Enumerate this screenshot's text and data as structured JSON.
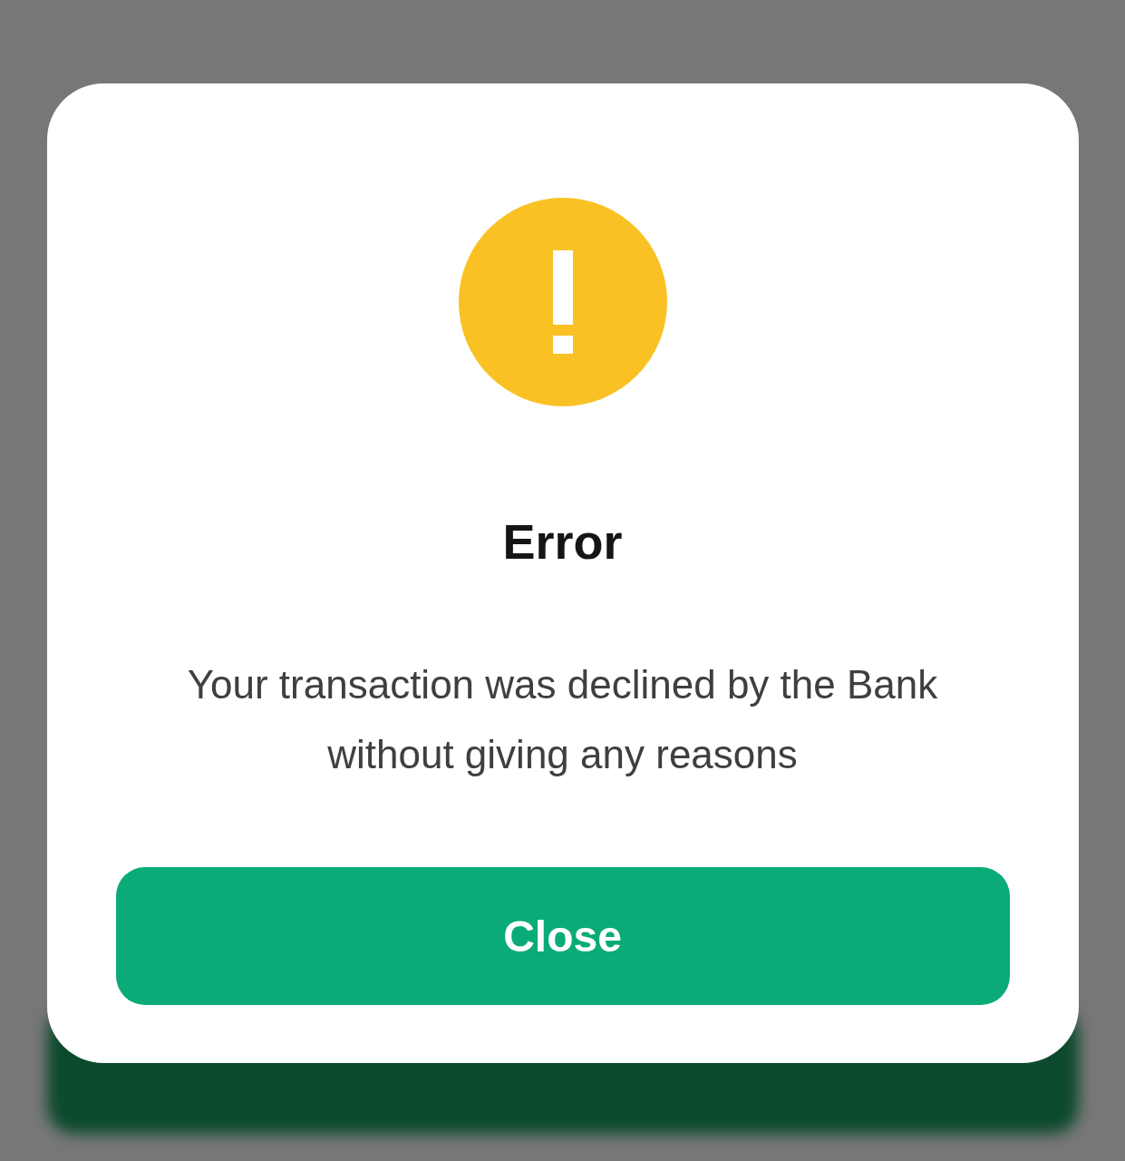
{
  "dialog": {
    "title": "Error",
    "message": "Your transaction was declined by the Bank without giving any reasons",
    "button": "Close"
  }
}
